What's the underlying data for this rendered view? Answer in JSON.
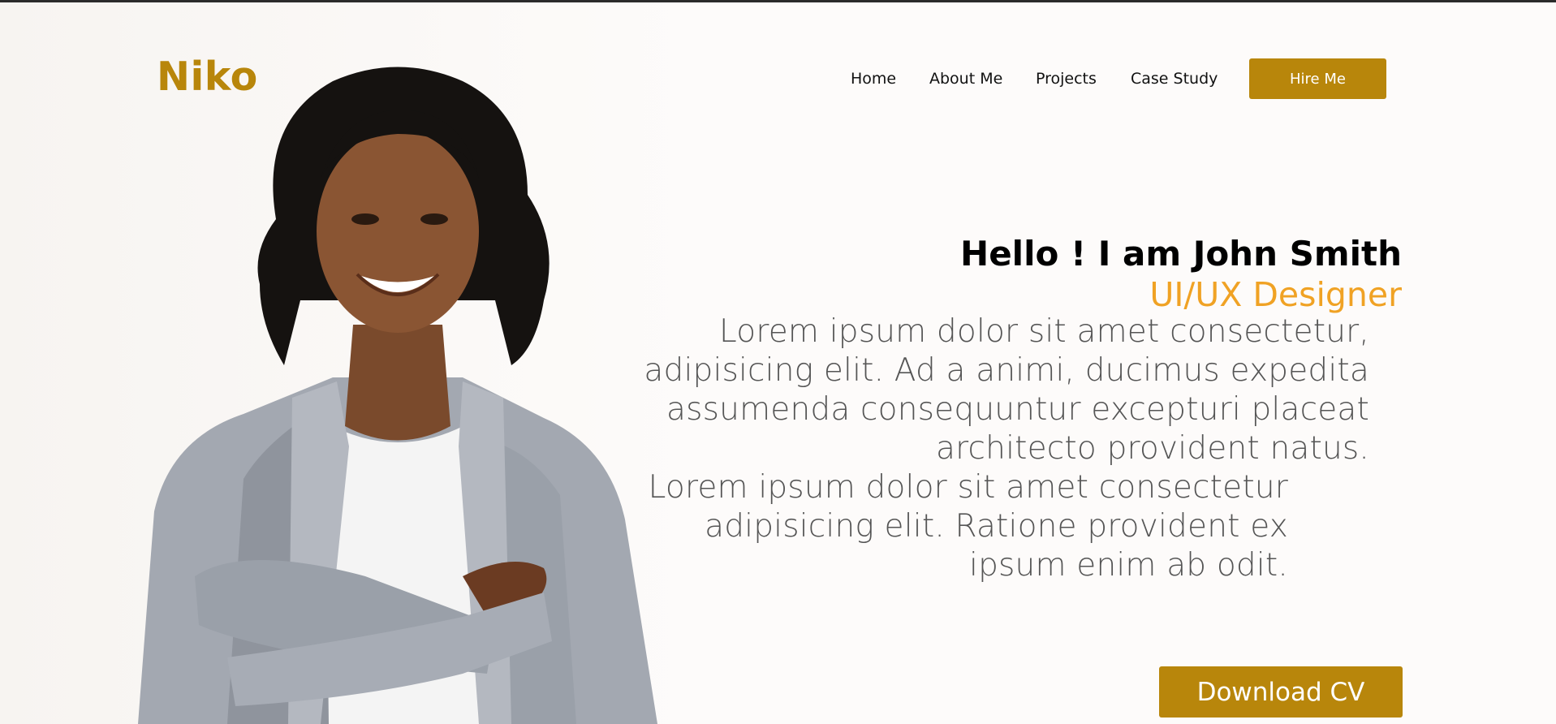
{
  "brand": {
    "logo_text": "Niko",
    "accent_color": "#b8860b"
  },
  "nav": {
    "items": [
      {
        "label": "Home"
      },
      {
        "label": "About Me"
      },
      {
        "label": "Projects"
      },
      {
        "label": "Case Study"
      }
    ],
    "cta_label": "Hire Me"
  },
  "hero": {
    "greeting": "Hello ! I am John Smith",
    "role": "UI/UX Designer",
    "role_color": "#f0a224",
    "paragraph_1": "Lorem ipsum dolor sit amet consectetur, adipisicing elit. Ad a animi, ducimus expedita assumenda consequuntur excepturi placeat architecto provident natus.",
    "paragraph_2": "Lorem ipsum dolor sit amet consectetur adipisicing elit. Ratione provident ex ipsum enim ab odit.",
    "download_label": "Download CV"
  },
  "portrait": {
    "icon": "person-portrait-photo"
  }
}
